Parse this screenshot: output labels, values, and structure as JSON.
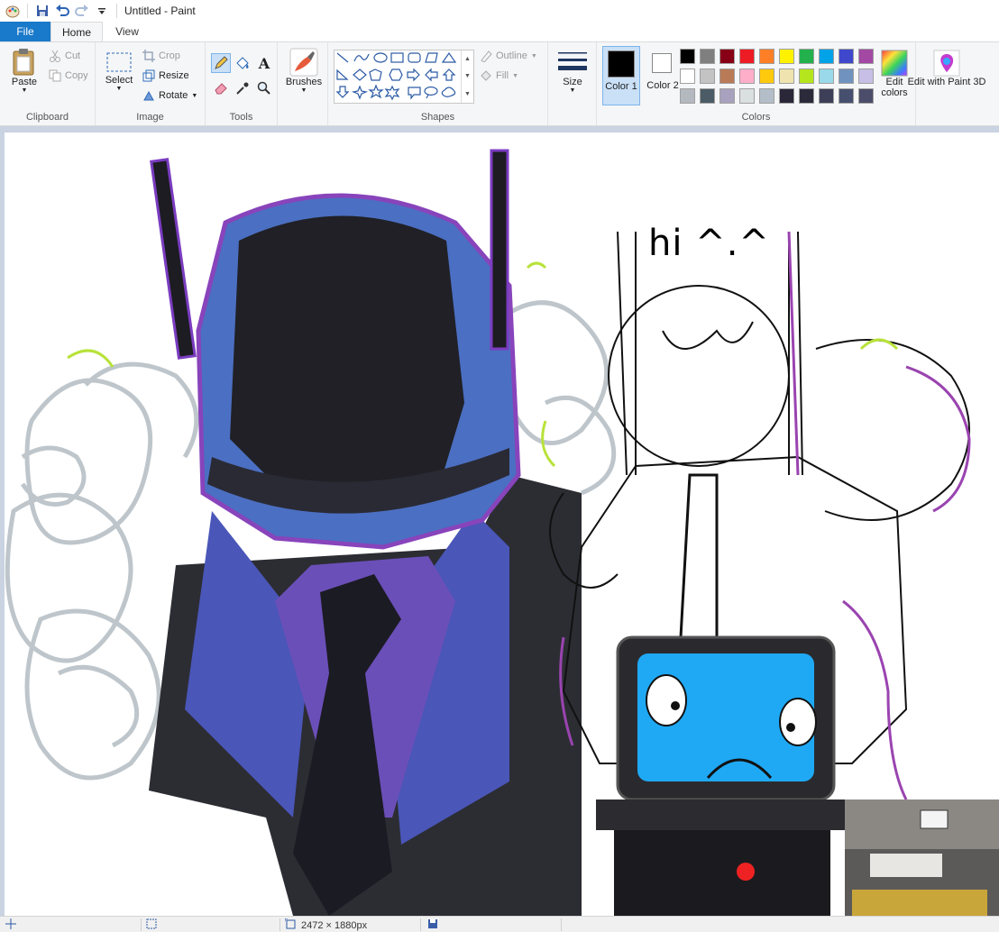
{
  "window": {
    "title": "Untitled - Paint"
  },
  "tabs": [
    {
      "label": "File"
    },
    {
      "label": "Home"
    },
    {
      "label": "View"
    }
  ],
  "clipboard": {
    "paste": "Paste",
    "cut": "Cut",
    "copy": "Copy",
    "group": "Clipboard"
  },
  "image": {
    "select": "Select",
    "crop": "Crop",
    "resize": "Resize",
    "rotate": "Rotate",
    "group": "Image"
  },
  "tools": {
    "group": "Tools",
    "items": [
      "pencil-icon",
      "fill-bucket-icon",
      "text-icon",
      "eraser-icon",
      "color-picker-icon",
      "magnifier-icon"
    ]
  },
  "brushes": {
    "label": "Brushes"
  },
  "shapes": {
    "group": "Shapes",
    "outline": "Outline",
    "fill": "Fill"
  },
  "size": {
    "label": "Size"
  },
  "colors": {
    "group": "Colors",
    "color1_label": "Color 1",
    "color2_label": "Color 2",
    "color1_value": "#000000",
    "color2_value": "#ffffff",
    "edit_colors": "Edit colors",
    "edit_paint3d": "Edit with Paint 3D",
    "palette": [
      "#000000",
      "#7f7f7f",
      "#880015",
      "#ed1c24",
      "#ff7f27",
      "#fff200",
      "#22b14c",
      "#00a2e8",
      "#3f48cc",
      "#a349a4",
      "#ffffff",
      "#c3c3c3",
      "#b97a57",
      "#ffaec9",
      "#ffc90e",
      "#efe4b0",
      "#b5e61d",
      "#99d9ea",
      "#7092be",
      "#c8bfe7",
      "#b4b9c0",
      "#4b5c66",
      "#a8a2be",
      "#dadfe0",
      "#b3bec8",
      "#2a2738",
      "#2b2a3a",
      "#3d3f58",
      "#474f6f",
      "#4c4d6a"
    ]
  },
  "canvas": {
    "caption": "hi ^.^"
  },
  "status": {
    "dimensions": "2472 × 1880px"
  }
}
